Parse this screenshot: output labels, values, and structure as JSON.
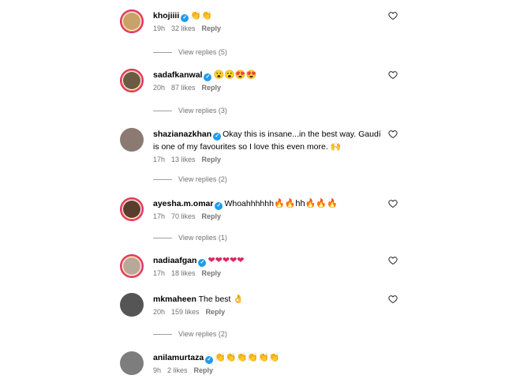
{
  "comments": [
    {
      "user": "khojiiii",
      "text": "",
      "emoji": "👏👏",
      "time": "19h",
      "likes": "32 likes",
      "reply": "Reply",
      "view_replies": "View replies (5)",
      "avatar_color": "#c9a26a"
    },
    {
      "user": "sadafkanwal",
      "text": "",
      "emoji": "😮😮😍😍",
      "time": "20h",
      "likes": "87 likes",
      "reply": "Reply",
      "view_replies": "View replies (3)",
      "avatar_color": "#6b5a44"
    },
    {
      "user": "shazianazkhan",
      "text": "Okay this is insane...in the best way. Gaudí is one of my favourites so I love this even more.",
      "emoji": "🙌",
      "time": "17h",
      "likes": "13 likes",
      "reply": "Reply",
      "view_replies": "View replies (2)",
      "avatar_color": "#8a7a72"
    },
    {
      "user": "ayesha.m.omar",
      "text": "Whoahhhhhh",
      "emoji": "🔥🔥hh🔥🔥🔥",
      "time": "17h",
      "likes": "70 likes",
      "reply": "Reply",
      "view_replies": "View replies (1)",
      "avatar_color": "#5a3d2f"
    },
    {
      "user": "nadiaafgan",
      "text": "",
      "emoji": "❤❤❤❤❤",
      "time": "17h",
      "likes": "18 likes",
      "reply": "Reply",
      "view_replies": "",
      "avatar_color": "#b8a898"
    },
    {
      "user": "mkmaheen",
      "text": "The best",
      "emoji": "👌",
      "time": "20h",
      "likes": "159 likes",
      "reply": "Reply",
      "view_replies": "View replies (2)",
      "avatar_color": "#555555"
    },
    {
      "user": "anilamurtaza",
      "text": "",
      "emoji": "👏👏👏👏👏👏",
      "time": "9h",
      "likes": "2 likes",
      "reply": "Reply",
      "view_replies": "",
      "avatar_color": "#7d7d7d"
    }
  ],
  "icons": {
    "verified": "verified-badge-icon",
    "like": "heart-outline-icon"
  }
}
